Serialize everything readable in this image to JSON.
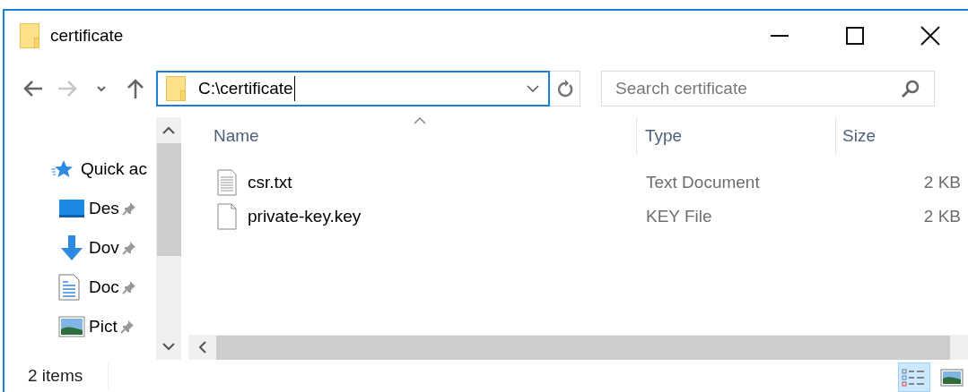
{
  "window": {
    "title": "certificate"
  },
  "address_bar": {
    "path": "C:\\certificate"
  },
  "search": {
    "placeholder": "Search certificate"
  },
  "nav_buttons": [
    {
      "kind": "back",
      "disabled": false
    },
    {
      "kind": "forward",
      "disabled": true
    },
    {
      "kind": "recent",
      "disabled": false
    },
    {
      "kind": "up",
      "disabled": false
    }
  ],
  "sidebar": {
    "items": [
      {
        "label": "Quick ac",
        "kind": "quick",
        "pinned": false
      },
      {
        "label": "Des",
        "kind": "desktop",
        "pinned": true
      },
      {
        "label": "Dov",
        "kind": "downloads",
        "pinned": true
      },
      {
        "label": "Doc",
        "kind": "documents",
        "pinned": true
      },
      {
        "label": "Pict",
        "kind": "pictures",
        "pinned": true
      }
    ]
  },
  "table": {
    "columns": [
      "Name",
      "Type",
      "Size"
    ],
    "rows": [
      {
        "name": "csr.txt",
        "kind": "text",
        "type": "Text Document",
        "size": "2 KB"
      },
      {
        "name": "private-key.key",
        "kind": "blank",
        "type": "KEY File",
        "size": "2 KB"
      }
    ]
  },
  "status_bar": {
    "count": "2 items"
  },
  "view_buttons": [
    {
      "kind": "details",
      "selected": true
    },
    {
      "kind": "large-icons",
      "selected": false
    }
  ]
}
